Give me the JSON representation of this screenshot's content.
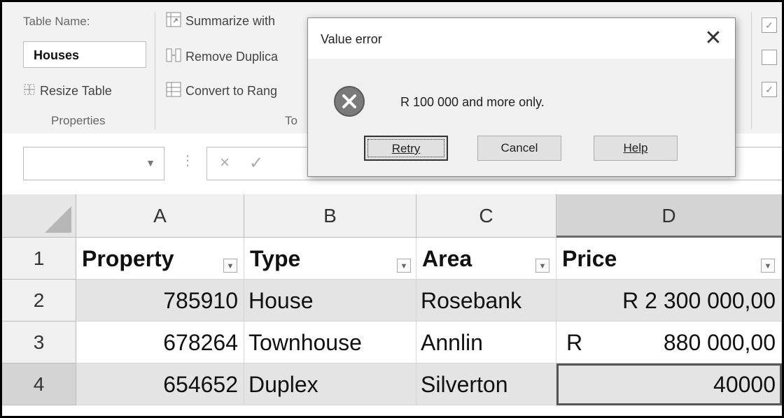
{
  "ribbon": {
    "table_name_label": "Table Name:",
    "table_name_value": "Houses",
    "resize_table": "Resize Table",
    "properties_group": "Properties",
    "summarize": "Summarize with",
    "remove_duplicates": "Remove Duplica",
    "convert_to_range": "Convert to Rang",
    "tools_group": "To",
    "checkboxes": [
      "✓",
      "",
      "✓"
    ]
  },
  "formula_bar": {
    "namebox_value": "",
    "cancel_symbol": "×",
    "enter_symbol": "✓",
    "dots": "⋮"
  },
  "sheet": {
    "columns": [
      "A",
      "B",
      "C",
      "D"
    ],
    "rows": [
      "1",
      "2",
      "3",
      "4"
    ],
    "headers": [
      "Property",
      "Type",
      "Area",
      "Price"
    ],
    "data": [
      [
        "785910",
        "House",
        "Rosebank",
        "R 2 300 000,00"
      ],
      [
        "678264",
        "Townhouse",
        "Annlin",
        "880 000,00"
      ],
      [
        "654652",
        "Duplex",
        "Silverton",
        "40000"
      ]
    ],
    "currency_symbol": "R"
  },
  "dialog": {
    "title": "Value error",
    "message": "R 100 000 and more only.",
    "retry_label": "Retry",
    "cancel_label": "Cancel",
    "help_label": "Help",
    "close_symbol": "✕"
  },
  "colors": {
    "band": "#e4e4e4",
    "selected_header": "#d4d4d4",
    "error_icon": "#7a7a7a"
  }
}
